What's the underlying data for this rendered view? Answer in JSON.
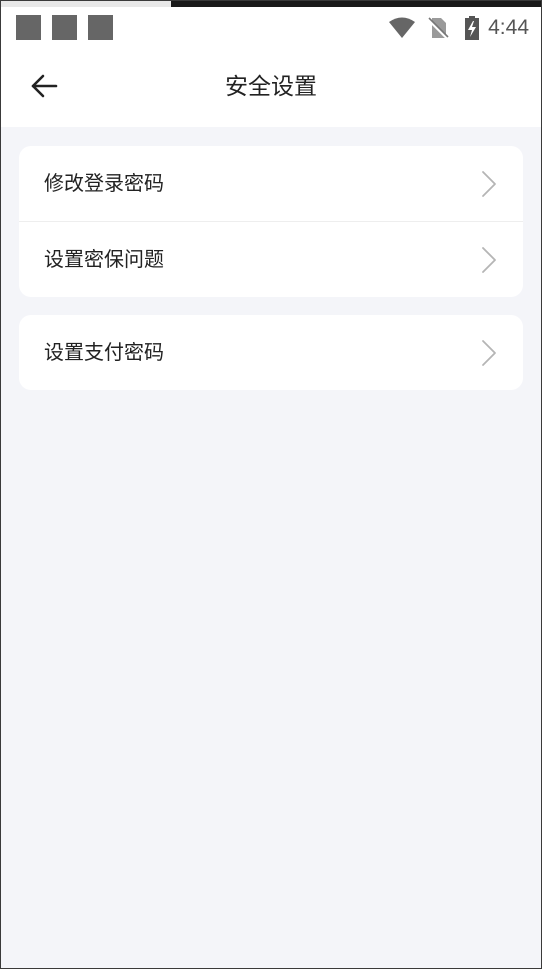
{
  "status_bar": {
    "time": "4:44",
    "icons": [
      "notification-square-icon",
      "notification-square-icon",
      "notification-square-icon",
      "wifi-icon",
      "no-sim-icon",
      "battery-charging-icon"
    ]
  },
  "header": {
    "title": "安全设置",
    "back_icon": "arrow-left-icon"
  },
  "sections": [
    {
      "items": [
        {
          "label": "修改登录密码",
          "icon": "chevron-right-icon"
        },
        {
          "label": "设置密保问题",
          "icon": "chevron-right-icon"
        }
      ]
    },
    {
      "items": [
        {
          "label": "设置支付密码",
          "icon": "chevron-right-icon"
        }
      ]
    }
  ],
  "colors": {
    "background": "#f4f5f9",
    "card": "#ffffff",
    "text": "#222222",
    "chevron": "#b5b5b5",
    "status_icon": "#666666"
  }
}
